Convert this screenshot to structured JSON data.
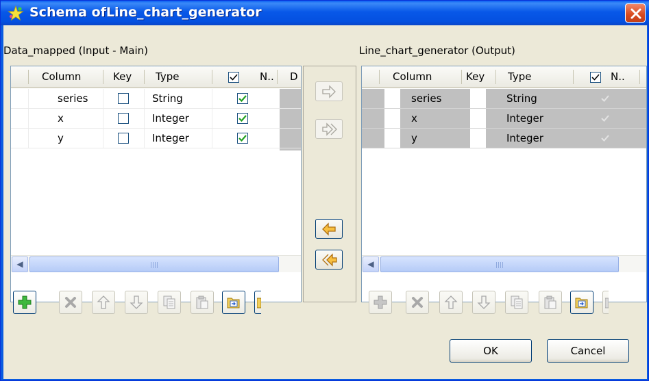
{
  "window": {
    "title": "Schema ofLine_chart_generator"
  },
  "input_panel": {
    "label": "Data_mapped (Input - Main)",
    "columns": [
      "Column",
      "Key",
      "Type",
      "N..",
      "D"
    ],
    "rows": [
      {
        "column": "series",
        "key": false,
        "type": "String",
        "nullable": true
      },
      {
        "column": "x",
        "key": false,
        "type": "Integer",
        "nullable": true
      },
      {
        "column": "y",
        "key": false,
        "type": "Integer",
        "nullable": true
      }
    ]
  },
  "output_panel": {
    "label": "Line_chart_generator (Output)",
    "columns": [
      "Column",
      "Key",
      "Type",
      "N.."
    ],
    "rows": [
      {
        "column": "series",
        "key": false,
        "type": "String",
        "nullable": true
      },
      {
        "column": "x",
        "key": false,
        "type": "Integer",
        "nullable": true
      },
      {
        "column": "y",
        "key": false,
        "type": "Integer",
        "nullable": true
      }
    ]
  },
  "transfer_buttons": [
    {
      "icon": "arrow-right-icon",
      "enabled": false
    },
    {
      "icon": "double-arrow-right-icon",
      "enabled": false
    },
    {
      "icon": "arrow-left-icon",
      "enabled": true
    },
    {
      "icon": "double-arrow-left-icon",
      "enabled": true
    }
  ],
  "toolbar_icons": [
    "add-icon",
    "remove-icon",
    "move-up-icon",
    "move-down-icon",
    "copy-icon",
    "paste-icon",
    "import-icon",
    "export-icon"
  ],
  "buttons": {
    "ok": "OK",
    "cancel": "Cancel"
  },
  "colors": {
    "titlebar": "#0a5be0",
    "dialog_bg": "#ece9d8",
    "check_green": "#21a121",
    "arrow_orange": "#f0a020"
  }
}
